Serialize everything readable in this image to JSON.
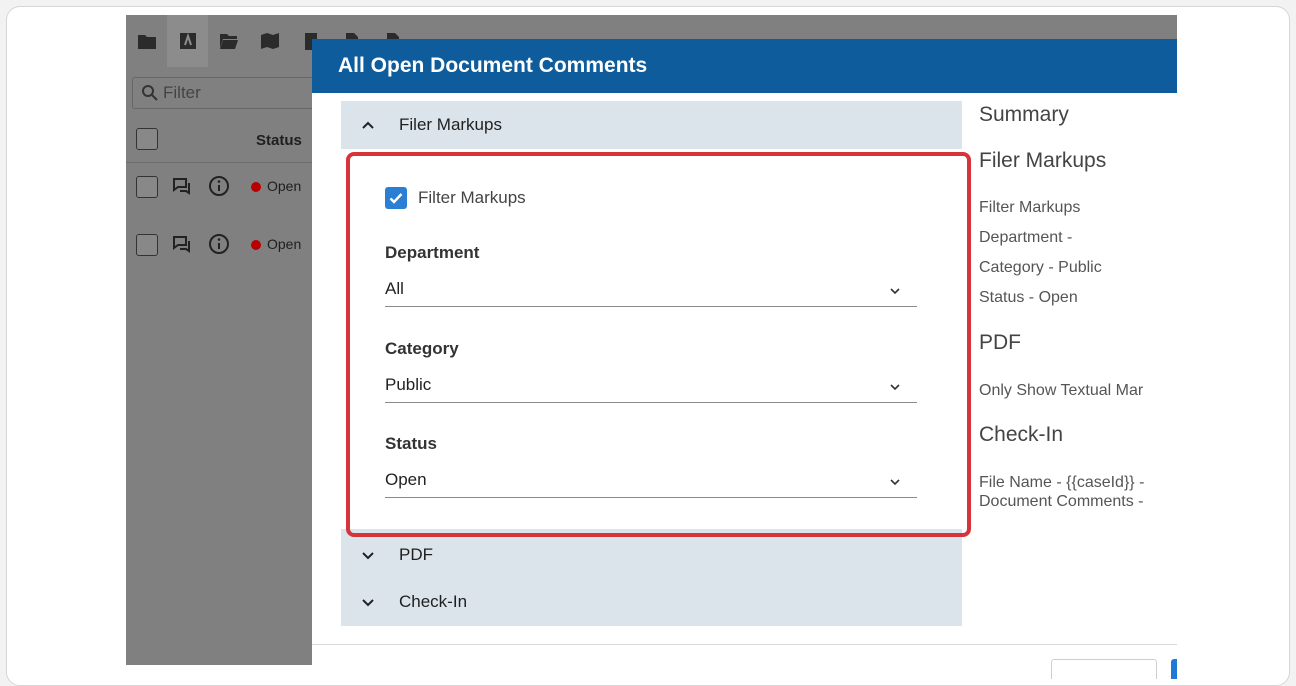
{
  "app": {
    "filter_placeholder": "Filter",
    "status_header": "Status",
    "rows": [
      {
        "status": "Open"
      },
      {
        "status": "Open"
      }
    ]
  },
  "dialog": {
    "title": "All Open Document Comments",
    "sections": {
      "filer_markups": {
        "label": "Filer Markups"
      },
      "pdf": {
        "label": "PDF"
      },
      "check_in": {
        "label": "Check-In"
      }
    },
    "filter_checkbox": {
      "label": "Filter Markups",
      "checked": true
    },
    "fields": {
      "department": {
        "label": "Department",
        "value": "All"
      },
      "category": {
        "label": "Category",
        "value": "Public"
      },
      "status": {
        "label": "Status",
        "value": "Open"
      }
    },
    "summary": {
      "title": "Summary",
      "filer_markups_heading": "Filer Markups",
      "filer_lines": [
        "Filter Markups",
        "Department -",
        "Category - Public",
        "Status - Open"
      ],
      "pdf_heading": "PDF",
      "pdf_lines": [
        "Only Show Textual Mar"
      ],
      "check_in_heading": "Check-In",
      "check_in_lines": [
        "File Name - {{caseId}} -",
        "Document Comments -"
      ]
    }
  },
  "colors": {
    "titlebar": "#0e5c9c",
    "accordion_bg": "#dbe4eb",
    "highlight": "#d6333a",
    "checkbox": "#2a7fd4",
    "status_dot": "#b80000"
  },
  "icons": {
    "folder": "folder-icon",
    "bookmark": "bookmark-icon",
    "open_folder": "open-folder-icon",
    "map": "map-icon",
    "document": "document-icon",
    "search": "search-icon",
    "comments": "comments-icon",
    "info": "info-icon",
    "chevron_up": "chevron-up-icon",
    "chevron_down": "chevron-down-icon",
    "check": "check-icon"
  }
}
